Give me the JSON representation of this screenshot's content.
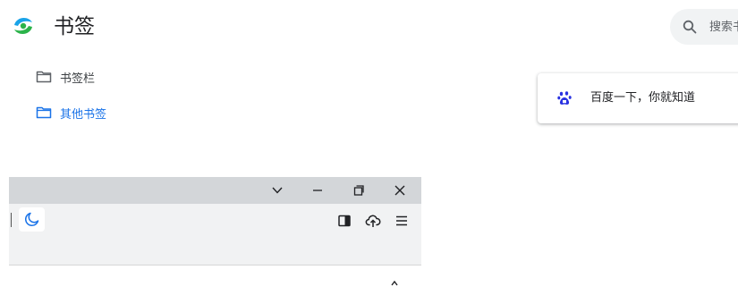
{
  "header": {
    "title": "书签"
  },
  "search": {
    "placeholder": "搜索书签"
  },
  "folders": [
    {
      "label": "书签栏",
      "selected": false
    },
    {
      "label": "其他书签",
      "selected": true
    }
  ],
  "bookmarks": [
    {
      "title": "百度一下，你就知道",
      "icon": "baidu-paw-icon"
    }
  ],
  "colors": {
    "accent": "#1a73e8",
    "titlebar": "#d3d6d9",
    "toolbar": "#f1f2f3"
  }
}
